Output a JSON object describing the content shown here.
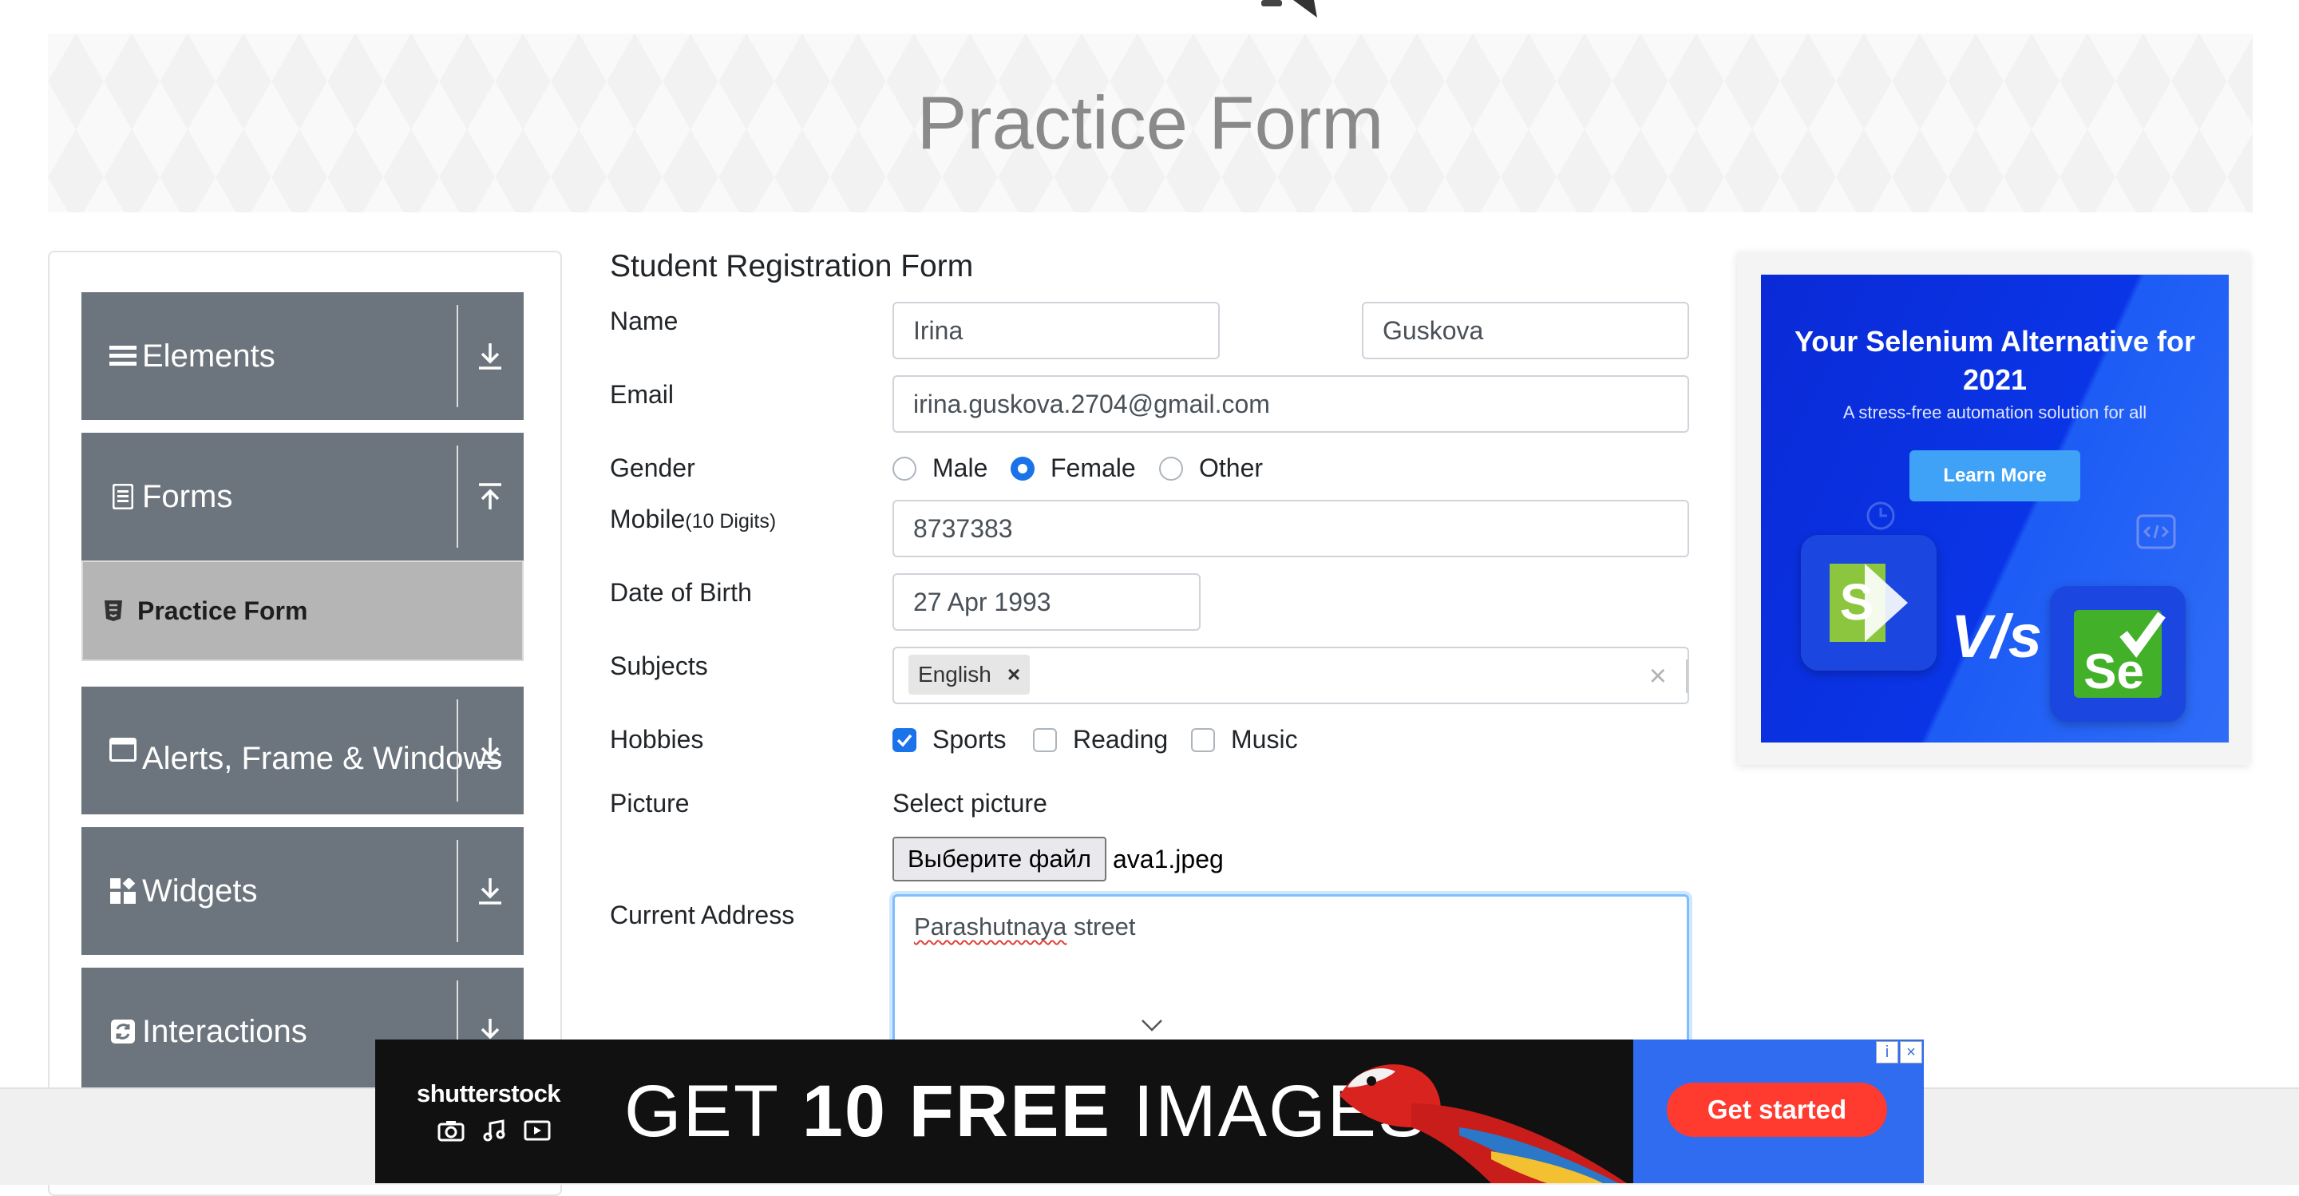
{
  "header": {
    "title": "Practice Form"
  },
  "sidebar": {
    "groups": [
      {
        "label": "Elements",
        "icon": "list-icon",
        "arrow": "download-arrow-icon"
      },
      {
        "label": "Forms",
        "icon": "document-icon",
        "arrow": "upload-arrow-icon"
      },
      {
        "label": "Alerts, Frame & Windows",
        "icon": "window-icon",
        "arrow": "download-arrow-icon"
      },
      {
        "label": "Widgets",
        "icon": "widgets-icon",
        "arrow": "download-arrow-icon"
      },
      {
        "label": "Interactions",
        "icon": "interactions-icon",
        "arrow": "download-arrow-icon"
      }
    ],
    "active_item": {
      "label": "Practice Form",
      "icon": "html5-icon"
    }
  },
  "form": {
    "title": "Student Registration Form",
    "name_label": "Name",
    "first_name": "Irina",
    "last_name": "Guskova",
    "email_label": "Email",
    "email": "irina.guskova.2704@gmail.com",
    "gender_label": "Gender",
    "gender_options": [
      "Male",
      "Female",
      "Other"
    ],
    "gender_selected": "Female",
    "mobile_label": "Mobile",
    "mobile_hint": "(10 Digits)",
    "mobile": "8737383",
    "dob_label": "Date of Birth",
    "dob": "27 Apr 1993",
    "subjects_label": "Subjects",
    "subjects": [
      "English"
    ],
    "subjects_clear": "×",
    "hobbies_label": "Hobbies",
    "hobbies": [
      {
        "label": "Sports",
        "checked": true
      },
      {
        "label": "Reading",
        "checked": false
      },
      {
        "label": "Music",
        "checked": false
      }
    ],
    "picture_label": "Picture",
    "picture_caption": "Select picture",
    "file_button": "Выберите файл",
    "file_name": "ava1.jpeg",
    "address_label": "Current Address",
    "address_word1": "Parashutnaya",
    "address_word2": "street"
  },
  "ad_right": {
    "title": "Your Selenium Alternative for 2021",
    "subtitle": "A stress-free automation solution for all",
    "button": "Learn More",
    "vs": "V/s",
    "logo_left": "S",
    "logo_right": "Se"
  },
  "ad_bottom": {
    "brand": "shutterstock",
    "headline_pre": "GET",
    "headline_strong": "10 FREE",
    "headline_post": "IMAGES",
    "cta": "Get started"
  },
  "colors": {
    "sidebar_bg": "#6c757d",
    "active_item_bg": "#b5b5b5",
    "accent": "#1a73e8",
    "ad_blue": "#0a2ad6",
    "ad_cta": "#ff3b2f"
  }
}
